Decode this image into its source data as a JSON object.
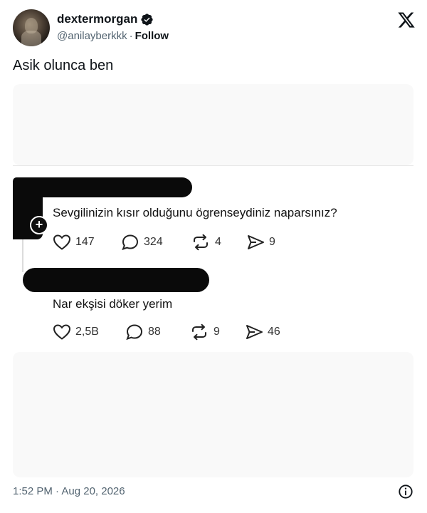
{
  "author": {
    "display_name": "dextermorgan",
    "handle": "@anilayberkkk",
    "separator": "·",
    "follow_label": "Follow"
  },
  "tweet": {
    "text": "Asik olunca ben",
    "timestamp": "1:52 PM · Aug 20, 2026"
  },
  "embedded_screenshot": {
    "post": {
      "text": "Sevgilinizin kısır olduğunu ögrenseydiniz naparsınız?",
      "likes": "147",
      "replies": "324",
      "reposts": "4",
      "shares": "9"
    },
    "reply": {
      "text": "Nar ekşisi döker yerim",
      "likes": "2,5B",
      "replies": "88",
      "reposts": "9",
      "shares": "46"
    },
    "plus_badge": "+"
  },
  "colors": {
    "text_primary": "#0f1419",
    "text_secondary": "#536471",
    "verified_badge": "#0f1419",
    "redaction": "#0a0a0a"
  }
}
